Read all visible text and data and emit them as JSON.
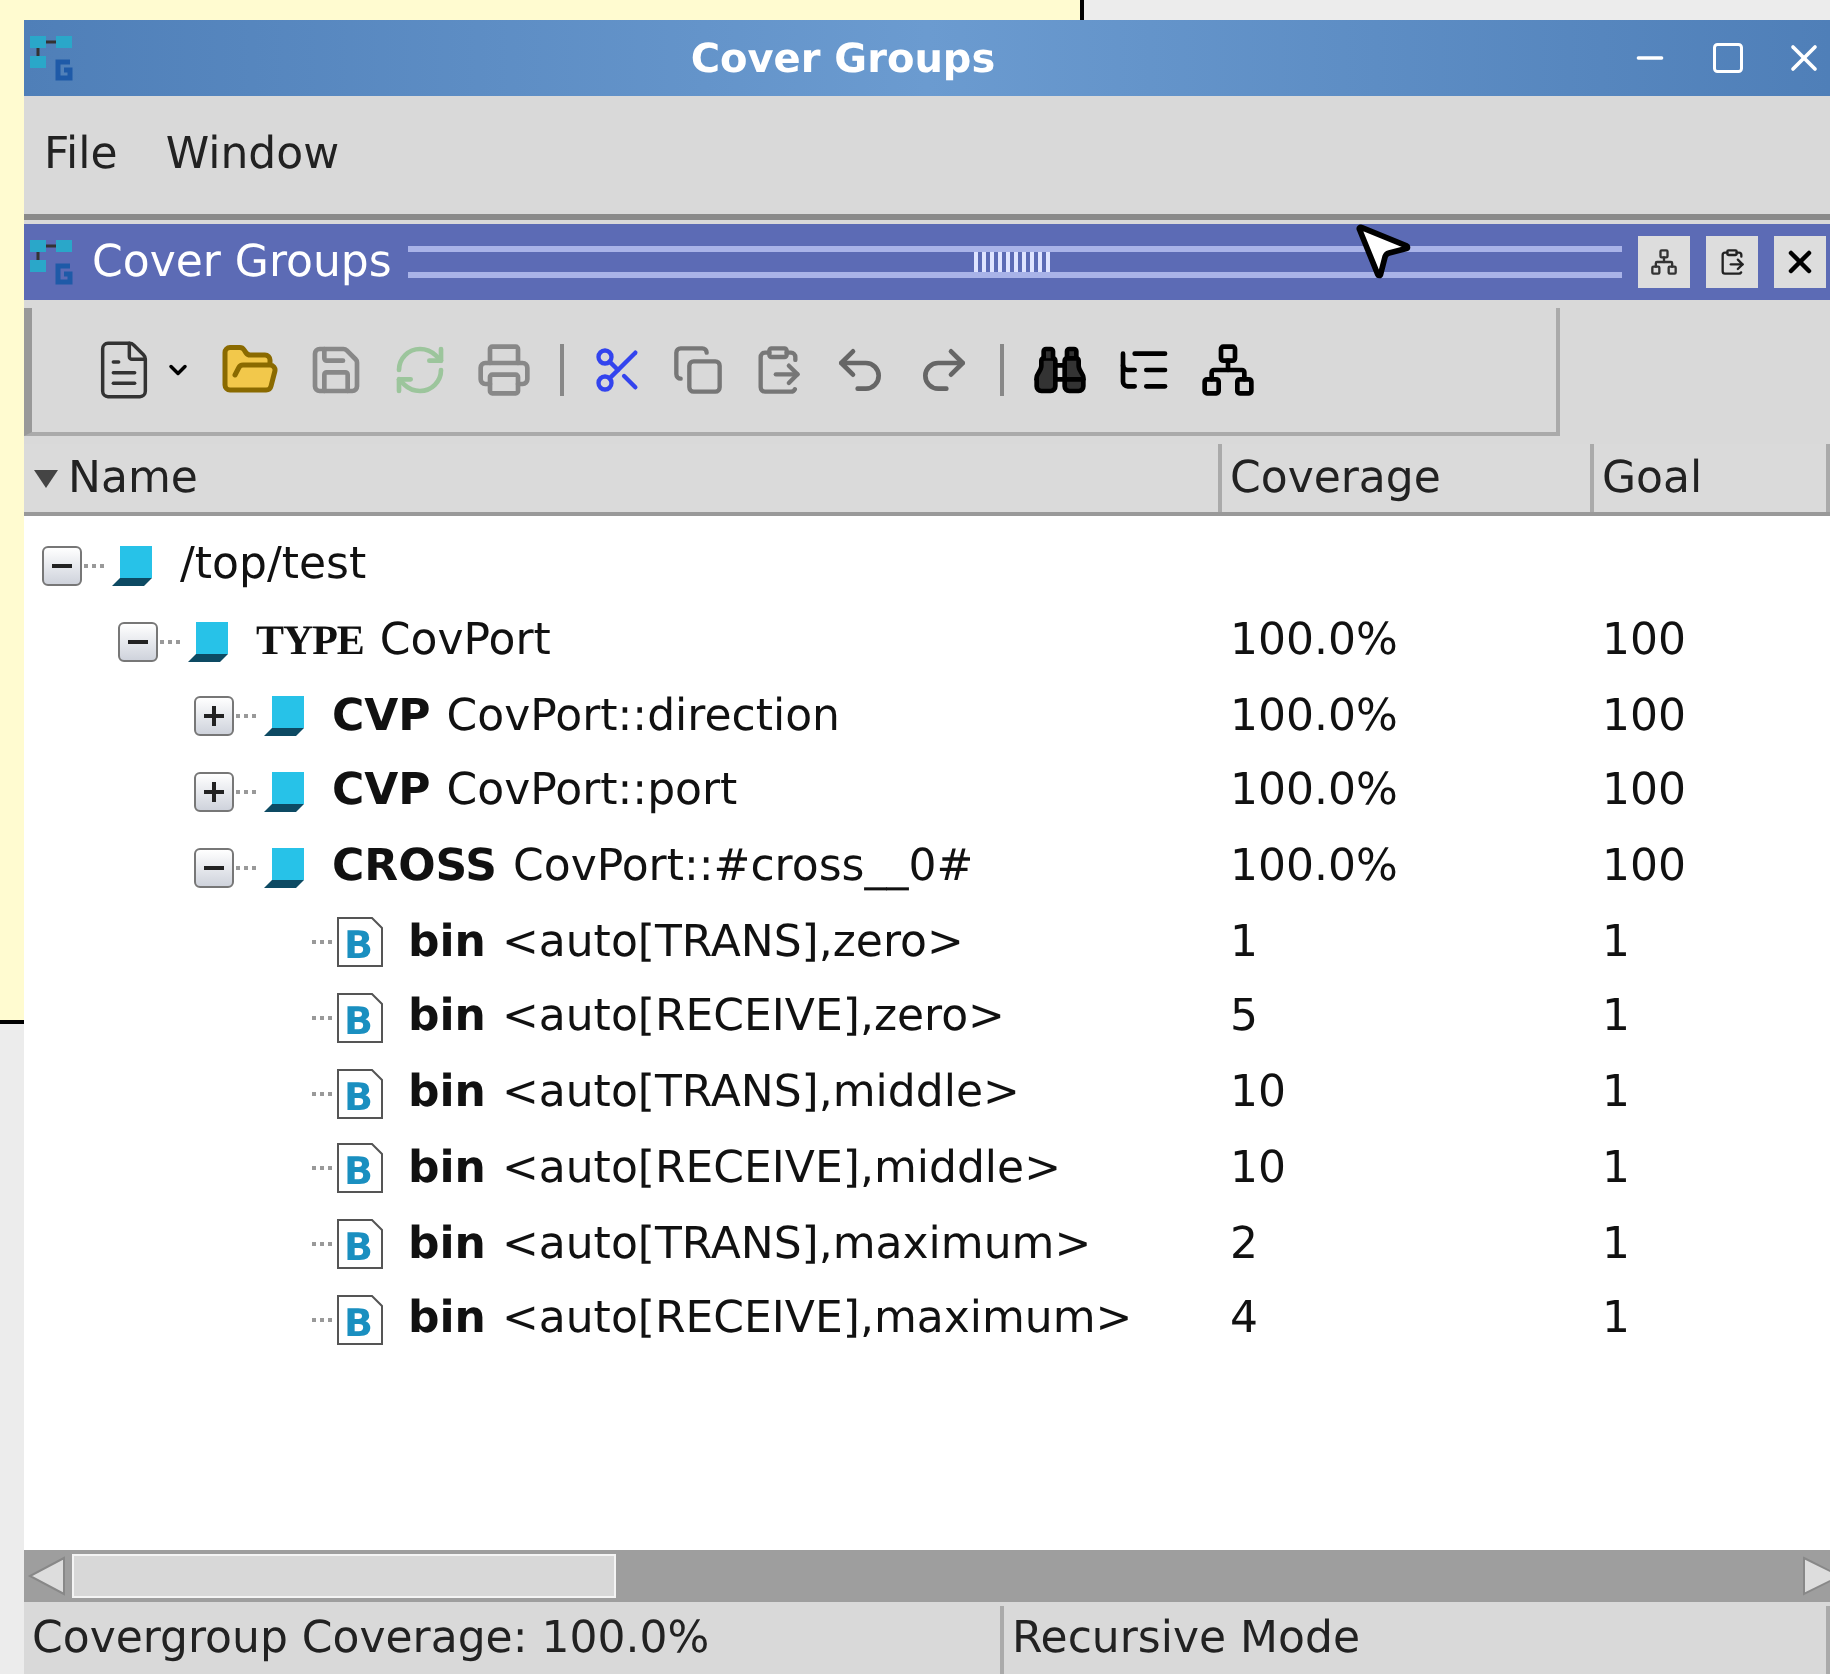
{
  "window": {
    "title": "Cover Groups"
  },
  "menu": [
    "File",
    "Window"
  ],
  "panel": {
    "title": "Cover Groups"
  },
  "columns": [
    "Name",
    "Coverage",
    "Goal"
  ],
  "tree": [
    {
      "kind": "group",
      "name": "/top/test",
      "expanded": true,
      "children": [
        {
          "kind": "type",
          "keyword": "TYPE",
          "name": "CovPort",
          "coverage": "100.0%",
          "goal": "100",
          "expanded": true,
          "children": [
            {
              "kind": "group",
              "keyword": "CVP",
              "name": "CovPort::direction",
              "coverage": "100.0%",
              "goal": "100",
              "expanded": false
            },
            {
              "kind": "group",
              "keyword": "CVP",
              "name": "CovPort::port",
              "coverage": "100.0%",
              "goal": "100",
              "expanded": false
            },
            {
              "kind": "group",
              "keyword": "CROSS",
              "name": "CovPort::#cross__0#",
              "coverage": "100.0%",
              "goal": "100",
              "expanded": true,
              "children": [
                {
                  "kind": "bin",
                  "icon_text": "B",
                  "keyword": "bin",
                  "name": "<auto[TRANS],zero>",
                  "coverage": "1",
                  "goal": "1"
                },
                {
                  "kind": "bin",
                  "icon_text": "B",
                  "keyword": "bin",
                  "name": "<auto[RECEIVE],zero>",
                  "coverage": "5",
                  "goal": "1"
                },
                {
                  "kind": "bin",
                  "icon_text": "B",
                  "keyword": "bin",
                  "name": "<auto[TRANS],middle>",
                  "coverage": "10",
                  "goal": "1"
                },
                {
                  "kind": "bin",
                  "icon_text": "B",
                  "keyword": "bin",
                  "name": "<auto[RECEIVE],middle>",
                  "coverage": "10",
                  "goal": "1"
                },
                {
                  "kind": "bin",
                  "icon_text": "B",
                  "keyword": "bin",
                  "name": "<auto[TRANS],maximum>",
                  "coverage": "2",
                  "goal": "1"
                },
                {
                  "kind": "bin",
                  "icon_text": "B",
                  "keyword": "bin",
                  "name": "<auto[RECEIVE],maximum>",
                  "coverage": "4",
                  "goal": "1"
                }
              ]
            }
          ]
        }
      ]
    }
  ],
  "status_bar": [
    "Covergroup Coverage: 100.0%",
    "Recursive Mode"
  ]
}
